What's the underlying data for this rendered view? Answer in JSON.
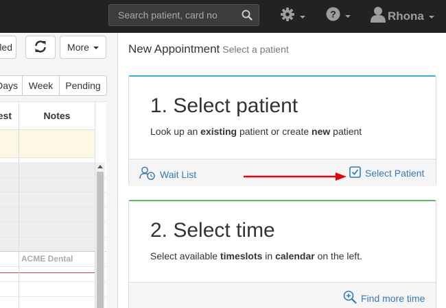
{
  "topbar": {
    "search_placeholder": "Search patient, card no",
    "user_name": "Rhona"
  },
  "left": {
    "buttons": {
      "partial_label": "led",
      "more_label": "More"
    },
    "view_tabs": [
      "Days",
      "Week",
      "Pending"
    ],
    "grid_headers": [
      "est",
      "Notes"
    ],
    "event_label": "ACME Dental"
  },
  "appointment": {
    "title": "New Appointment",
    "subtitle": "Select a patient",
    "step1": {
      "heading": "1. Select patient",
      "text_parts": [
        "Look up an ",
        "existing",
        " patient or create ",
        "new",
        " patient"
      ],
      "wait_list_label": "Wait List",
      "select_patient_label": "Select Patient",
      "accent_color": "#31b0d5"
    },
    "step2": {
      "heading": "2. Select time",
      "text_parts": [
        "Select available ",
        "timeslots",
        " in ",
        "calendar",
        " on the left."
      ],
      "find_more_label": "Find more time",
      "accent_color": "#5cb85c"
    }
  },
  "icons": {
    "search": "search-icon",
    "settings": "gear-icon",
    "help": "question-circle-icon",
    "user": "user-icon",
    "refresh": "refresh-icon",
    "wait_list": "user-clock-icon",
    "select": "checkbox-checked-icon",
    "find": "zoom-in-icon"
  },
  "colors": {
    "link": "#337ab7",
    "annotation_arrow": "#e8000b",
    "navbar": "#222222"
  }
}
